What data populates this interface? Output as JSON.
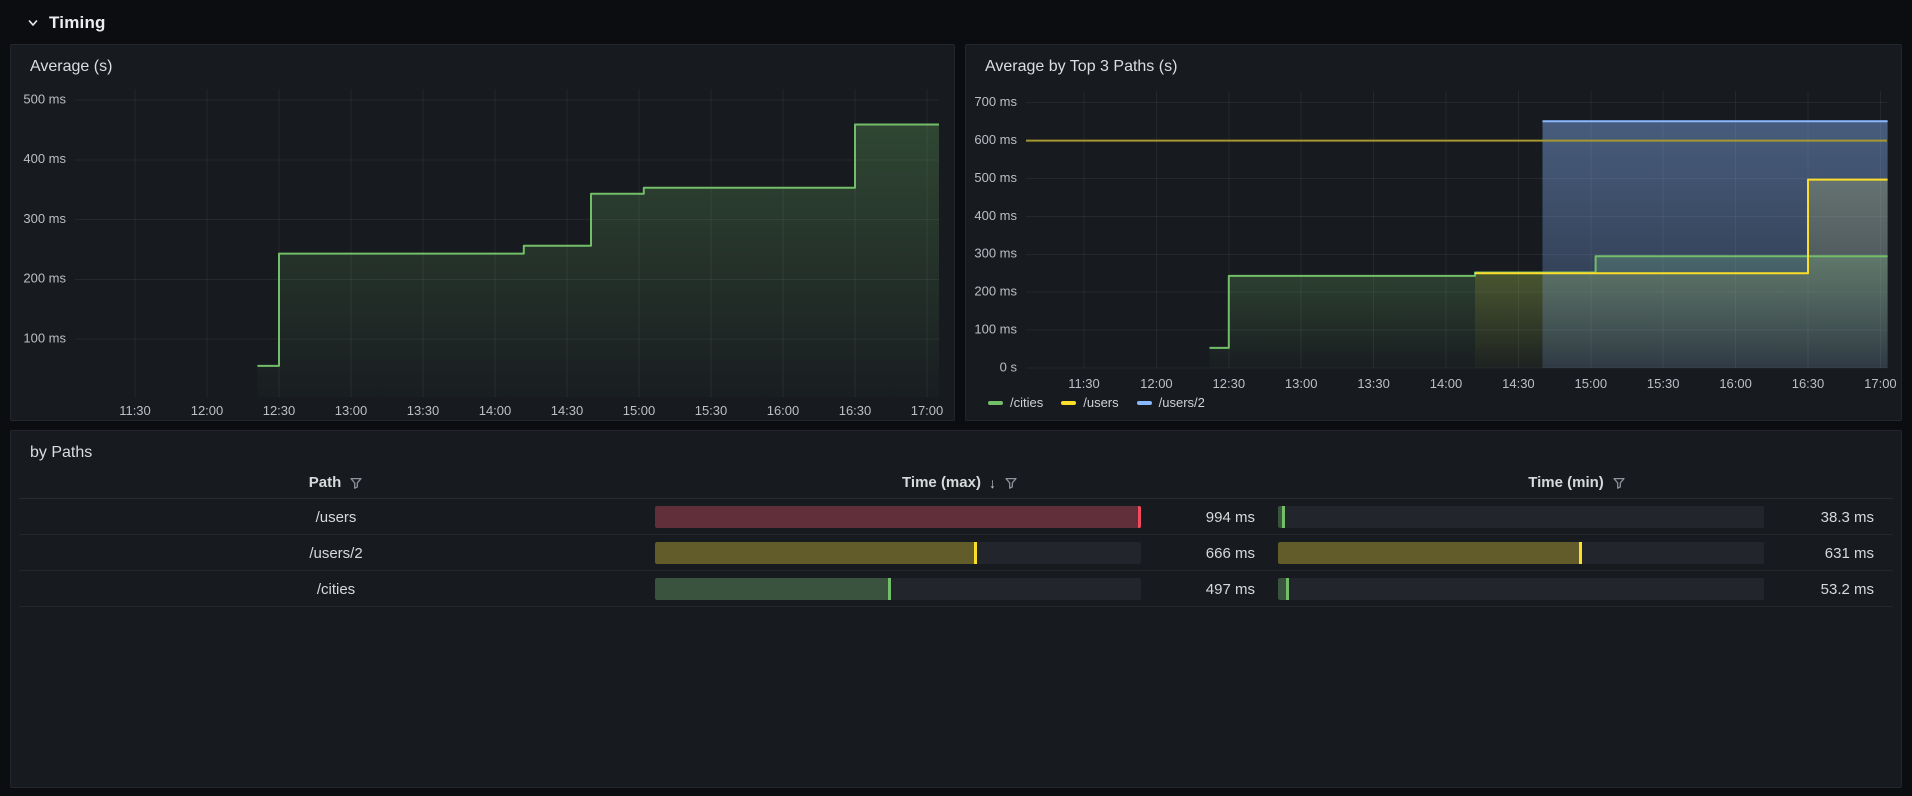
{
  "section": {
    "title": "Timing"
  },
  "time_axis": [
    "11:30",
    "12:00",
    "12:30",
    "13:00",
    "13:30",
    "14:00",
    "14:30",
    "15:00",
    "15:30",
    "16:00",
    "16:30",
    "17:00"
  ],
  "chart_data": [
    {
      "id": "avg",
      "type": "area",
      "title": "Average (s)",
      "unit": "ms",
      "grid": true,
      "legend_position": "none",
      "x_range": [
        "11:05",
        "17:05"
      ],
      "ylim": [
        0,
        515
      ],
      "y_ticks": [
        {
          "v": 500,
          "label": "500 ms"
        },
        {
          "v": 400,
          "label": "400 ms"
        },
        {
          "v": 300,
          "label": "300 ms"
        },
        {
          "v": 200,
          "label": "200 ms"
        },
        {
          "v": 100,
          "label": "100 ms"
        }
      ],
      "x_ticks": [
        "11:30",
        "12:00",
        "12:30",
        "13:00",
        "13:30",
        "14:00",
        "14:30",
        "15:00",
        "15:30",
        "16:00",
        "16:30",
        "17:00"
      ],
      "series": [
        {
          "name": "average",
          "color": "#73BF69",
          "fill_top": 0.27,
          "points": [
            [
              "12:21",
              55
            ],
            [
              "12:30",
              243
            ],
            [
              "14:12",
              256
            ],
            [
              "14:40",
              343
            ],
            [
              "15:02",
              353
            ],
            [
              "16:30",
              459
            ],
            [
              "17:05",
              459
            ]
          ]
        }
      ]
    },
    {
      "id": "avg-top3",
      "type": "area",
      "title": "Average by Top 3 Paths (s)",
      "unit": "ms",
      "grid": true,
      "legend_position": "bottom",
      "x_range": [
        "11:07",
        "17:03"
      ],
      "ylim": [
        0,
        730
      ],
      "threshold": {
        "value": 600,
        "color": "#a59731"
      },
      "y_ticks": [
        {
          "v": 700,
          "label": "700 ms"
        },
        {
          "v": 600,
          "label": "600 ms"
        },
        {
          "v": 500,
          "label": "500 ms"
        },
        {
          "v": 400,
          "label": "400 ms"
        },
        {
          "v": 300,
          "label": "300 ms"
        },
        {
          "v": 200,
          "label": "200 ms"
        },
        {
          "v": 100,
          "label": "100 ms"
        },
        {
          "v": 0,
          "label": "0 s"
        }
      ],
      "x_ticks": [
        "11:30",
        "12:00",
        "12:30",
        "13:00",
        "13:30",
        "14:00",
        "14:30",
        "15:00",
        "15:30",
        "16:00",
        "16:30",
        "17:00"
      ],
      "series": [
        {
          "name": "/cities",
          "color": "#73BF69",
          "fill_top": 0.27,
          "points": [
            [
              "12:22",
              53
            ],
            [
              "12:30",
              243
            ],
            [
              "14:12",
              252
            ],
            [
              "15:02",
              295
            ],
            [
              "17:03",
              295
            ]
          ]
        },
        {
          "name": "/users",
          "color": "#FADE2A",
          "fill_top": 0.25,
          "points": [
            [
              "14:12",
              250
            ],
            [
              "16:30",
              497
            ],
            [
              "17:03",
              497
            ]
          ]
        },
        {
          "name": "/users/2",
          "color": "#8AB8FF",
          "fill_top": 0.42,
          "fill_bottom": 0.16,
          "points": [
            [
              "14:40",
              651
            ],
            [
              "17:03",
              651
            ]
          ]
        }
      ]
    }
  ],
  "table": {
    "title": "by Paths",
    "columns": [
      {
        "label": "Path",
        "filter": true,
        "sort": null
      },
      {
        "label": "Time (max)",
        "filter": true,
        "sort": "desc"
      },
      {
        "label": "Time (min)",
        "filter": true,
        "sort": null
      }
    ],
    "gauge_range": {
      "min": 38.3,
      "max": 994
    },
    "rows": [
      {
        "path": "/users",
        "max": {
          "value": 994,
          "text": "994 ms",
          "color": "#F2495C"
        },
        "min": {
          "value": 38.3,
          "text": "38.3 ms",
          "color": "#73BF69"
        }
      },
      {
        "path": "/users/2",
        "max": {
          "value": 666,
          "text": "666 ms",
          "color": "#FADE2A"
        },
        "min": {
          "value": 631,
          "text": "631 ms",
          "color": "#FADE2A"
        }
      },
      {
        "path": "/cities",
        "max": {
          "value": 497,
          "text": "497 ms",
          "color": "#73BF69"
        },
        "min": {
          "value": 53.2,
          "text": "53.2 ms",
          "color": "#73BF69"
        }
      }
    ]
  },
  "colors": {
    "page_bg": "#0c0d11",
    "panel_bg": "#171a1f",
    "panel_border": "#23262c",
    "grid": "rgba(204,204,220,0.08)",
    "green": "#73BF69",
    "yellow": "#FADE2A",
    "blue": "#8AB8FF",
    "red": "#F2495C",
    "threshold": "#a59731",
    "gauge_track": "#22252b"
  },
  "icons": {
    "chevron": "chevron-down",
    "filter": "funnel",
    "sort_desc": "↓"
  }
}
